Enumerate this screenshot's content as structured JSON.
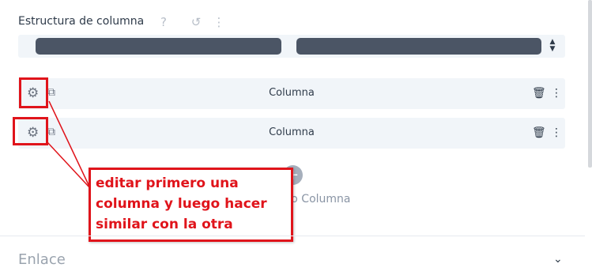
{
  "section": {
    "title": "Estructura de columna",
    "help_icon": "?",
    "undo_icon": "↺",
    "more_icon": "⋮"
  },
  "structure_select": {
    "arrows": "▲▼"
  },
  "columns": [
    {
      "label": "Columna",
      "gear_icon": "⚙",
      "duplicate_icon": "⧉",
      "trash_icon": "🗑",
      "more_icon": "⋮"
    },
    {
      "label": "Columna",
      "gear_icon": "⚙",
      "duplicate_icon": "⧉",
      "trash_icon": "🗑",
      "more_icon": "⋮"
    }
  ],
  "add_column": {
    "icon": "+",
    "label": "vo Columna"
  },
  "annotation": {
    "text": "editar primero una columna y luego hacer similar con la otra",
    "line1": "editar primero una",
    "line2": "columna y luego hacer",
    "line3": "similar con la otra",
    "color": "#e0141b"
  },
  "link_section": {
    "title": "Enlace",
    "chevron": "⌄"
  }
}
